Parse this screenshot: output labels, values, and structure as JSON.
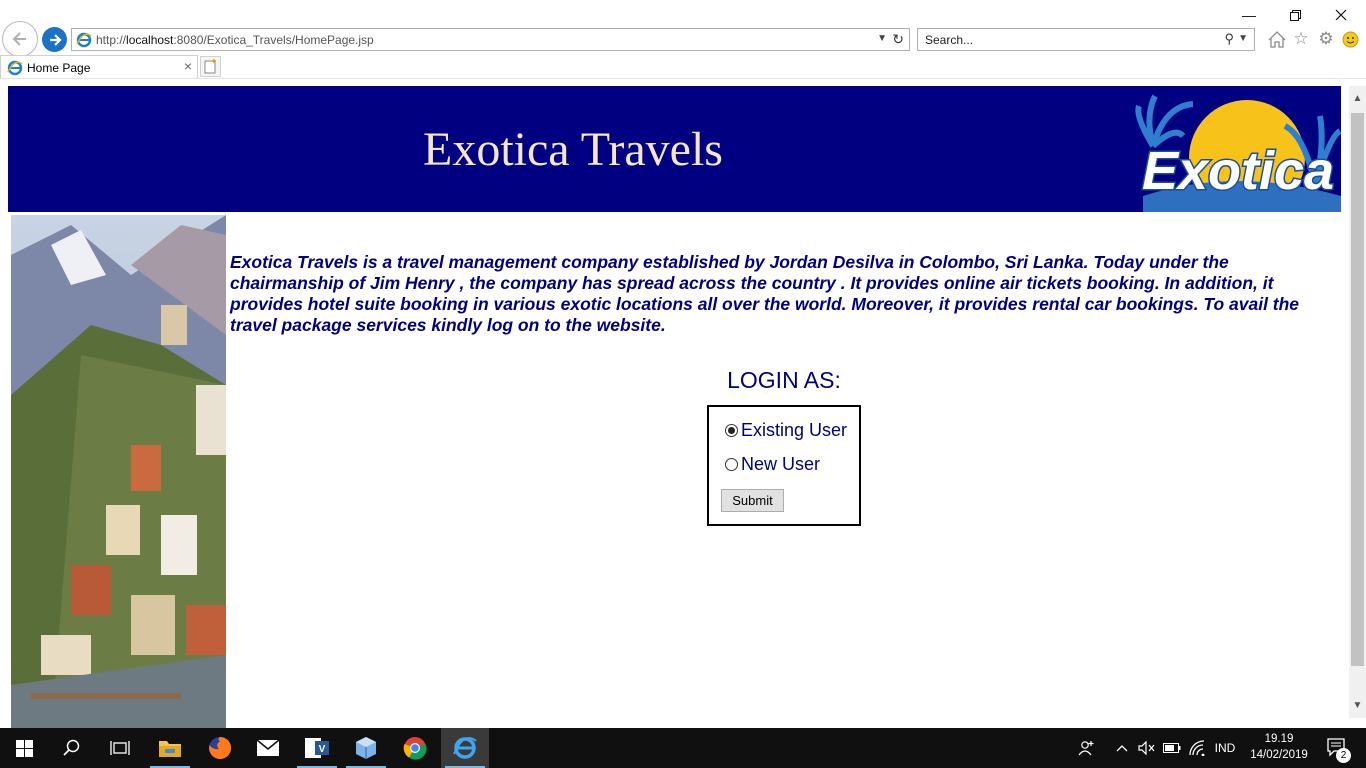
{
  "browser": {
    "address_url_prefix": "http://",
    "address_url_host": "localhost",
    "address_url_rest": ":8080/Exotica_Travels/HomePage.jsp",
    "search_placeholder": "Search...",
    "tab_title": "Home Page"
  },
  "header": {
    "title": "Exotica Travels",
    "logo_text": "Exotica"
  },
  "intro_text": "Exotica Travels is a travel management company established by Jordan Desilva in Colombo, Sri Lanka. Today under the chairmanship of Jim Henry , the company has spread across the country . It provides online air tickets booking. In addition, it provides hotel suite booking in various exotic locations all over the world. Moreover, it provides rental car bookings. To avail the travel package services kindly log on to the website.",
  "login": {
    "heading": "LOGIN AS:",
    "options": [
      {
        "label": "Existing User",
        "checked": true
      },
      {
        "label": "New User",
        "checked": false
      }
    ],
    "submit_label": "Submit"
  },
  "taskbar": {
    "language": "IND",
    "time": "19.19",
    "date": "14/02/2019",
    "notification_count": "2"
  },
  "colors": {
    "header_bg": "#000080",
    "text_navy": "#000080",
    "title_cream": "#f5e6c8"
  }
}
